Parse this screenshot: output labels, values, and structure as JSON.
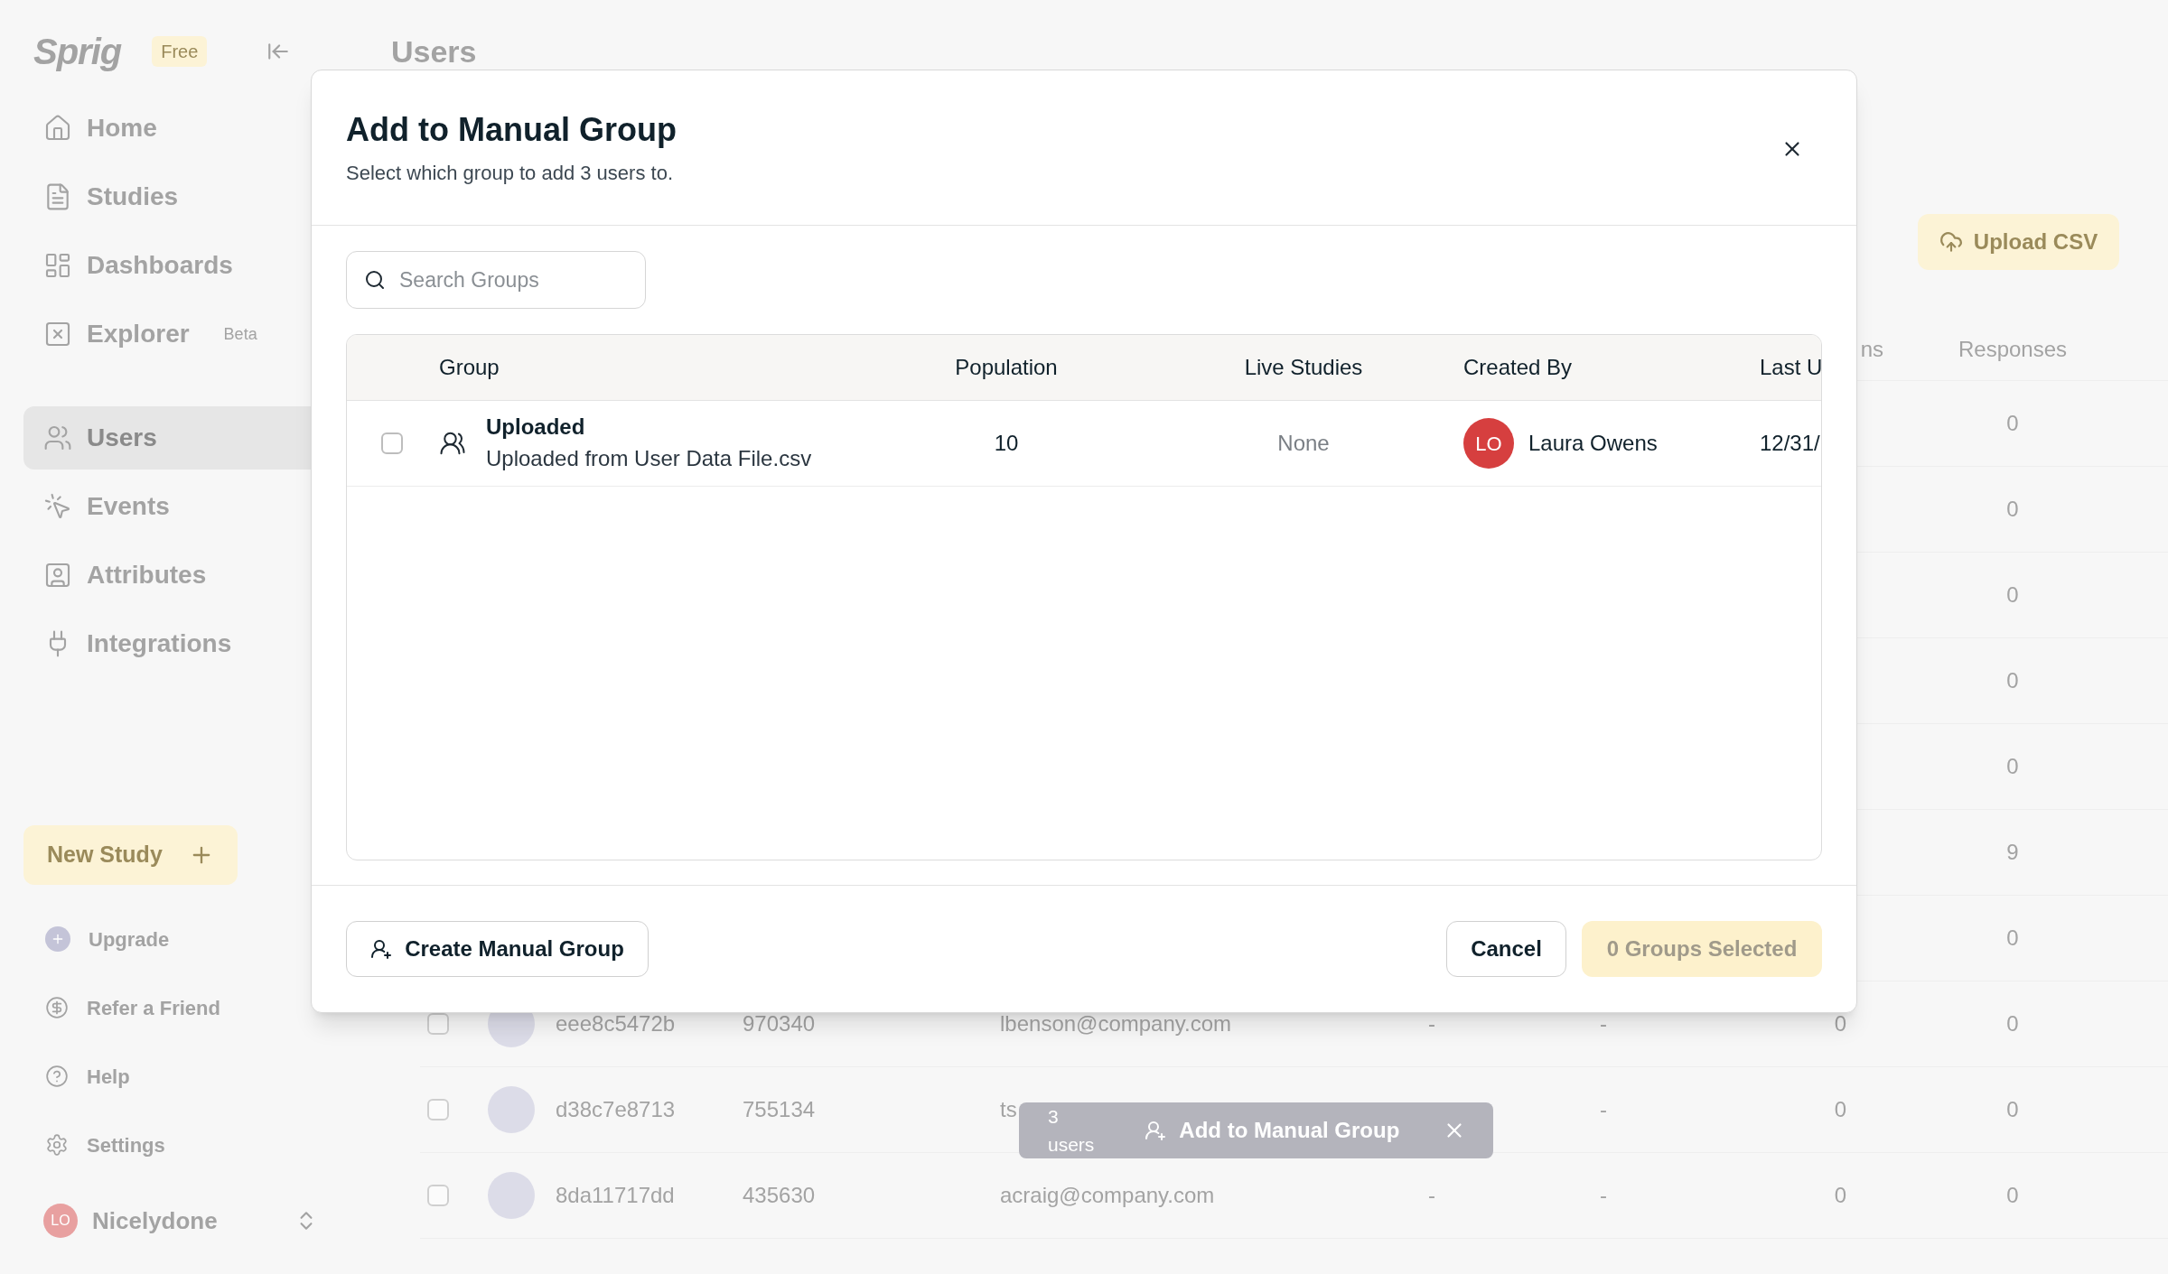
{
  "sidebar": {
    "logo": "Sprig",
    "plan_badge": "Free",
    "nav": [
      {
        "label": "Home",
        "kind": "home",
        "selected": false
      },
      {
        "label": "Studies",
        "kind": "studies",
        "selected": false
      },
      {
        "label": "Dashboards",
        "kind": "dashboards",
        "selected": false
      },
      {
        "label": "Explorer",
        "kind": "explorer",
        "badge": "Beta",
        "selected": false
      },
      {
        "label": "Users",
        "kind": "users",
        "selected": true
      },
      {
        "label": "Events",
        "kind": "events",
        "selected": false
      },
      {
        "label": "Attributes",
        "kind": "attributes",
        "selected": false
      },
      {
        "label": "Integrations",
        "kind": "integrations",
        "selected": false
      }
    ],
    "new_study": "New Study",
    "bottom": [
      {
        "label": "Upgrade",
        "kind": "upgrade"
      },
      {
        "label": "Refer a Friend",
        "kind": "refer"
      },
      {
        "label": "Help",
        "kind": "help"
      },
      {
        "label": "Settings",
        "kind": "settings"
      }
    ],
    "account": {
      "initials": "LO",
      "name": "Nicelydone"
    }
  },
  "page": {
    "title": "Users",
    "upload_button": "Upload CSV",
    "table": {
      "headers": {
        "column_8": "ns",
        "responses": "Responses"
      },
      "rows": [
        {
          "responses": "0"
        },
        {
          "responses": "0"
        },
        {
          "responses": "0"
        },
        {
          "responses": "0"
        },
        {
          "responses": "0"
        },
        {
          "responses": "9"
        },
        {
          "responses": "0"
        },
        {
          "checked": false,
          "id": "eee8c5472b",
          "number": "970340",
          "email": "lbenson@company.com",
          "column_6": "-",
          "column_7": "-",
          "column_8": "0",
          "responses": "0"
        },
        {
          "checked": false,
          "id": "d38c7e8713",
          "number": "755134",
          "email": "ts",
          "column_7": "-",
          "column_8": "0",
          "responses": "0"
        },
        {
          "checked": false,
          "id": "8da11717dd",
          "number": "435630",
          "email": "acraig@company.com",
          "column_6": "-",
          "column_7": "-",
          "column_8": "0",
          "responses": "0"
        }
      ]
    }
  },
  "action_bar": {
    "count": "3 users",
    "action": "Add to Manual Group"
  },
  "dialog": {
    "title": "Add to Manual Group",
    "subtitle": "Select which group to add 3 users to.",
    "search": {
      "placeholder": "Search Groups"
    },
    "table": {
      "columns": [
        "Group",
        "Population",
        "Live Studies",
        "Created By",
        "Last U"
      ],
      "rows": [
        {
          "checked": false,
          "name": "Uploaded",
          "description": "Uploaded from User Data File.csv",
          "population": "10",
          "live_studies": "None",
          "creator_initials": "LO",
          "creator": "Laura Owens",
          "last_updated": "12/31/"
        }
      ]
    },
    "create_button": "Create Manual Group",
    "cancel_button": "Cancel",
    "confirm_button": {
      "label": "0 Groups Selected",
      "disabled": true
    }
  }
}
